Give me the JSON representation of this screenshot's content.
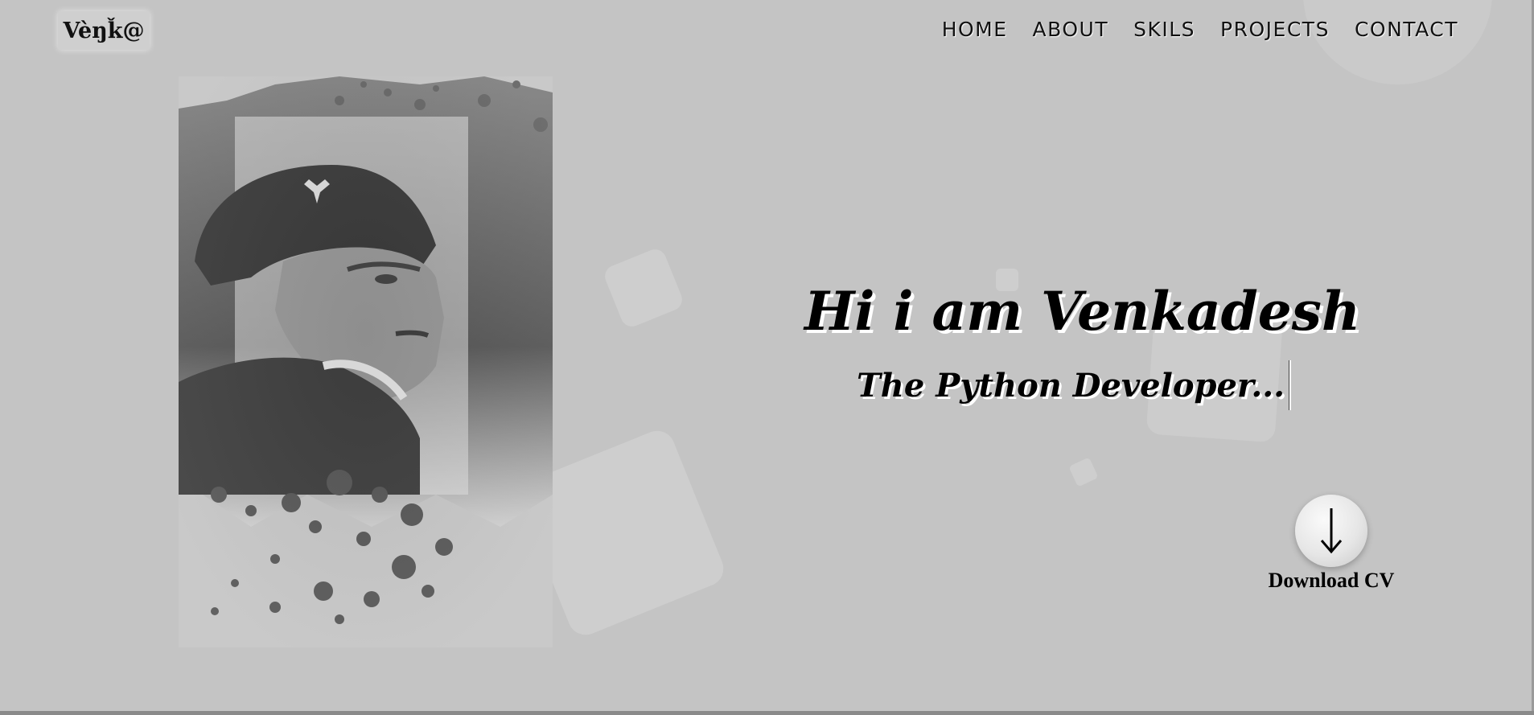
{
  "logo": {
    "text": "Vèŋǩ@"
  },
  "nav": {
    "items": [
      {
        "label": "HOME"
      },
      {
        "label": "ABOUT"
      },
      {
        "label": "SKILS"
      },
      {
        "label": "PROJECTS"
      },
      {
        "label": "CONTACT"
      }
    ]
  },
  "hero": {
    "title": "Hi i am Venkadesh",
    "subtitle": "The Python Developer..."
  },
  "download": {
    "label": "Download CV",
    "icon": "arrow-down-icon"
  },
  "colors": {
    "background": "#c4c4c4",
    "text": "#000000",
    "text_shadow": "#ffffff"
  }
}
